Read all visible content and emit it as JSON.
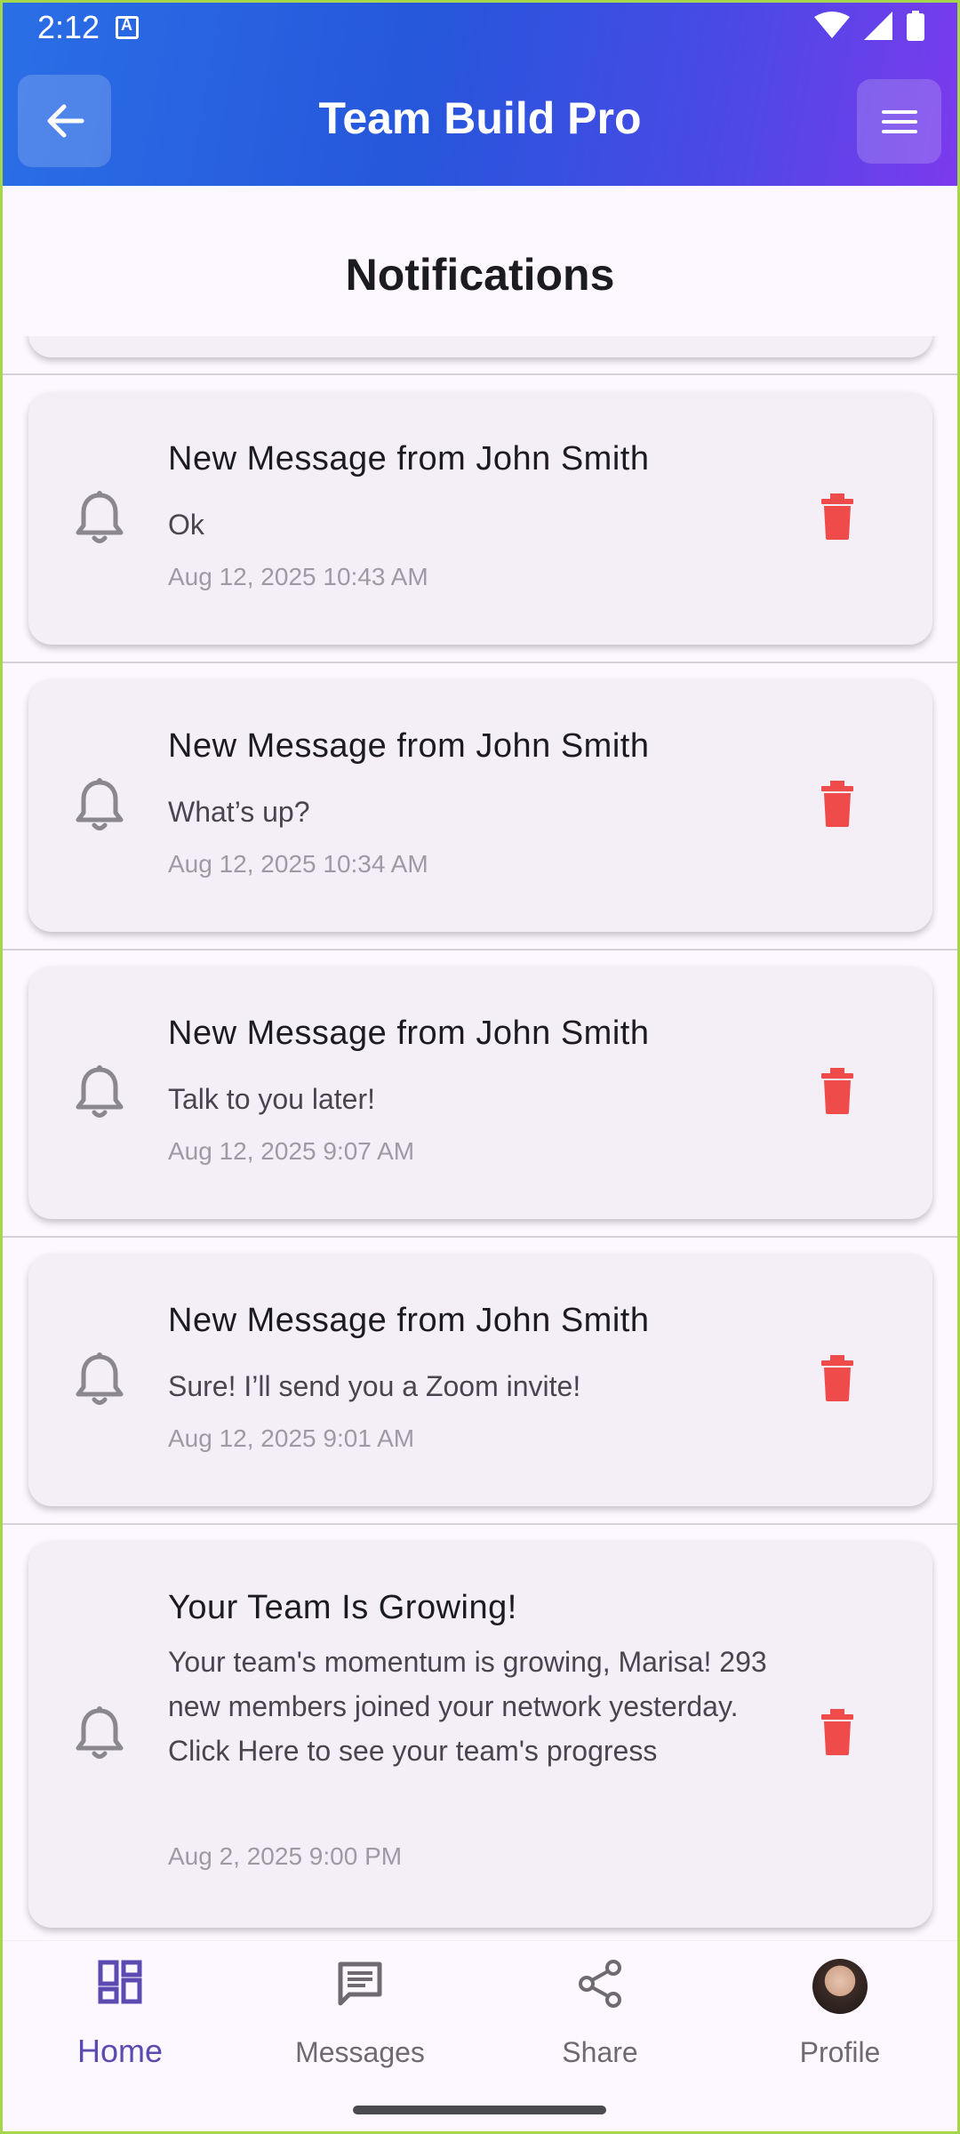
{
  "status_bar": {
    "time": "2:12"
  },
  "header": {
    "title": "Team Build Pro"
  },
  "page": {
    "title": "Notifications"
  },
  "notifications": [
    {
      "title": "New Message from John Smith",
      "body": "Ok",
      "time": "Aug 12, 2025 10:43 AM"
    },
    {
      "title": "New Message from John Smith",
      "body": "What’s up?",
      "time": "Aug 12, 2025 10:34 AM"
    },
    {
      "title": "New Message from John Smith",
      "body": "Talk to you later!",
      "time": "Aug 12, 2025 9:07 AM"
    },
    {
      "title": "New Message from John Smith",
      "body": "Sure! I’ll send you a Zoom invite!",
      "time": "Aug 12, 2025 9:01 AM"
    },
    {
      "title": "Your Team Is Growing!",
      "body": "Your team's momentum is growing, Marisa! 293 new members joined your network yesterday. Click Here to see your team's progress",
      "time": "Aug 2, 2025 9:00 PM"
    }
  ],
  "bottom_nav": {
    "items": [
      {
        "label": "Home",
        "icon": "dashboard-icon",
        "active": true
      },
      {
        "label": "Messages",
        "icon": "message-icon",
        "active": false
      },
      {
        "label": "Share",
        "icon": "share-icon",
        "active": false
      },
      {
        "label": "Profile",
        "icon": "avatar",
        "active": false
      }
    ]
  },
  "colors": {
    "header_gradient_start": "#2a6fe6",
    "header_gradient_end": "#7c3aed",
    "trash_red": "#f04b4b",
    "active_nav": "#5b4ab0",
    "card_bg": "#f4eff7"
  }
}
